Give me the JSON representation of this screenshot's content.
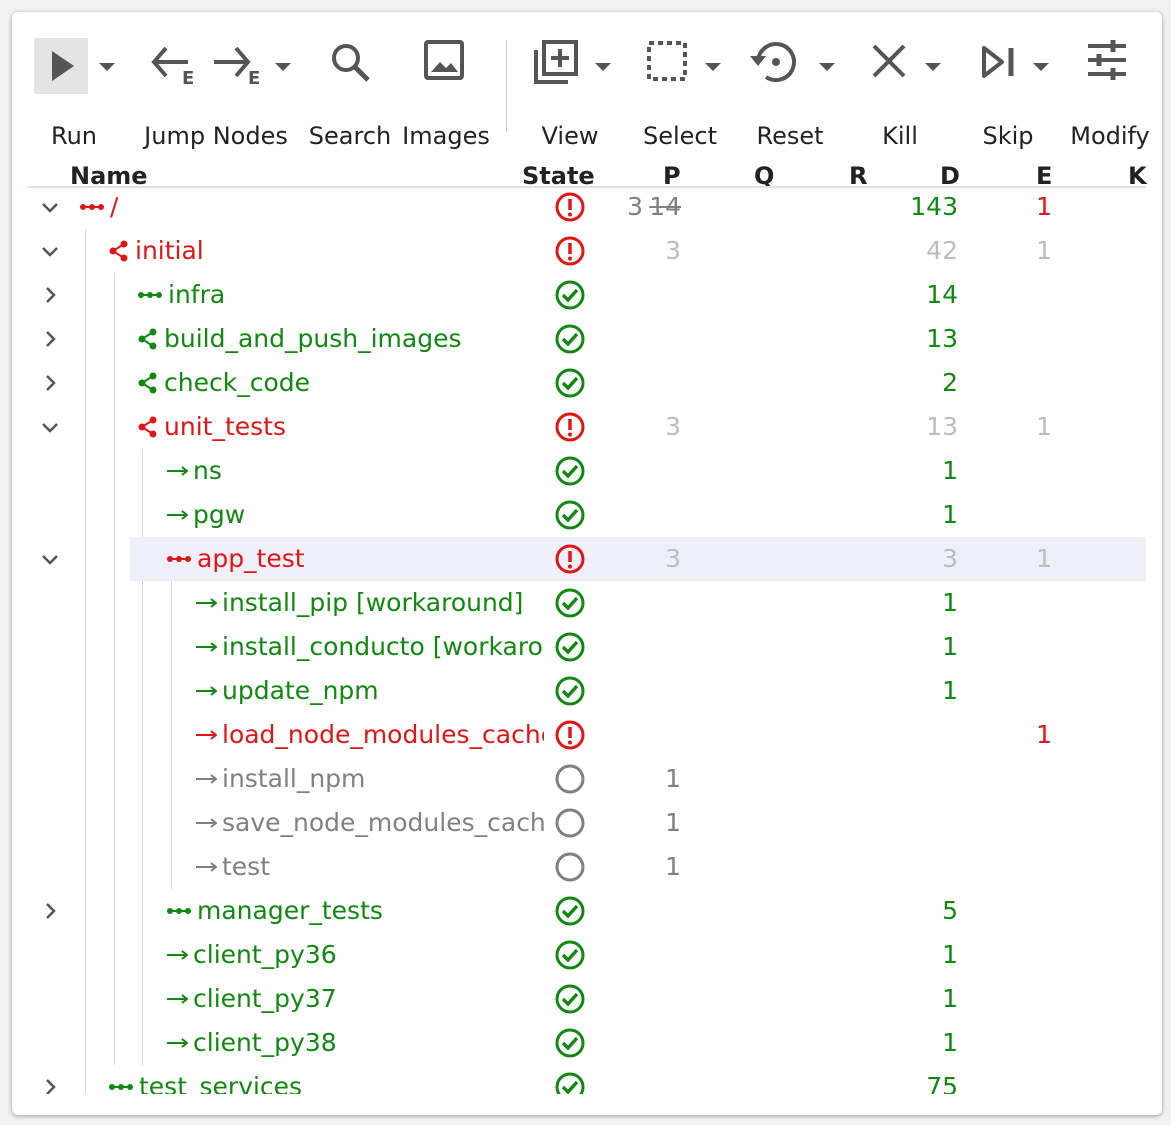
{
  "toolbar": {
    "run": "Run",
    "jump_nodes": "Jump Nodes",
    "jump_sub": "E",
    "search": "Search",
    "images": "Images",
    "view": "View",
    "select": "Select",
    "reset": "Reset",
    "kill": "Kill",
    "skip": "Skip",
    "modify": "Modify"
  },
  "columns": {
    "name": "Name",
    "state": "State",
    "p": "P",
    "q": "Q",
    "r": "R",
    "d": "D",
    "e": "E",
    "k": "K"
  },
  "colors": {
    "red": "#e01515",
    "green": "#118811",
    "gray": "#808080",
    "highlight": "#eeeff9"
  },
  "rows": [
    {
      "name": "/",
      "depth": 0,
      "expand": "open",
      "kind": "serial",
      "status": "error",
      "p": "3",
      "p_strike": "14",
      "d": "143",
      "e": "1",
      "faint": false
    },
    {
      "name": "initial",
      "depth": 1,
      "expand": "open",
      "kind": "parallel",
      "status": "error",
      "p": "3",
      "d": "42",
      "e": "1",
      "faint": true
    },
    {
      "name": "infra",
      "depth": 2,
      "expand": "closed",
      "kind": "serial",
      "status": "done",
      "d": "14"
    },
    {
      "name": "build_and_push_images",
      "depth": 2,
      "expand": "closed",
      "kind": "parallel",
      "status": "done",
      "d": "13"
    },
    {
      "name": "check_code",
      "depth": 2,
      "expand": "closed",
      "kind": "parallel",
      "status": "done",
      "d": "2"
    },
    {
      "name": "unit_tests",
      "depth": 2,
      "expand": "open",
      "kind": "parallel",
      "status": "error",
      "p": "3",
      "d": "13",
      "e": "1",
      "faint": true
    },
    {
      "name": "ns",
      "depth": 3,
      "kind": "exec",
      "status": "done",
      "d": "1"
    },
    {
      "name": "pgw",
      "depth": 3,
      "kind": "exec",
      "status": "done",
      "d": "1"
    },
    {
      "name": "app_test",
      "depth": 3,
      "expand": "open",
      "kind": "serial",
      "status": "error",
      "p": "3",
      "d": "3",
      "e": "1",
      "faint": true,
      "highlight": true
    },
    {
      "name": "install_pip [workaround]",
      "depth": 4,
      "kind": "exec",
      "status": "done",
      "d": "1"
    },
    {
      "name": "install_conducto [workaround]",
      "depth": 4,
      "kind": "exec",
      "status": "done",
      "d": "1"
    },
    {
      "name": "update_npm",
      "depth": 4,
      "kind": "exec",
      "status": "done",
      "d": "1"
    },
    {
      "name": "load_node_modules_cache",
      "depth": 4,
      "kind": "exec",
      "status": "error",
      "e": "1"
    },
    {
      "name": "install_npm",
      "depth": 4,
      "kind": "exec",
      "status": "pending",
      "p": "1"
    },
    {
      "name": "save_node_modules_cache",
      "depth": 4,
      "kind": "exec",
      "status": "pending",
      "p": "1"
    },
    {
      "name": "test",
      "depth": 4,
      "kind": "exec",
      "status": "pending",
      "p": "1"
    },
    {
      "name": "manager_tests",
      "depth": 3,
      "expand": "closed",
      "kind": "serial",
      "status": "done",
      "d": "5"
    },
    {
      "name": "client_py36",
      "depth": 3,
      "kind": "exec",
      "status": "done",
      "d": "1"
    },
    {
      "name": "client_py37",
      "depth": 3,
      "kind": "exec",
      "status": "done",
      "d": "1"
    },
    {
      "name": "client_py38",
      "depth": 3,
      "kind": "exec",
      "status": "done",
      "d": "1"
    },
    {
      "name": "test_services",
      "depth": 1,
      "expand": "closed",
      "kind": "serial",
      "status": "done",
      "d": "75"
    }
  ]
}
